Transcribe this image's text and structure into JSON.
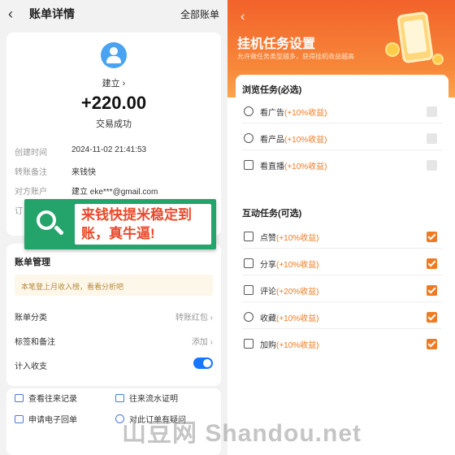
{
  "left": {
    "back_glyph": "‹",
    "title": "账单详情",
    "all_bills": "全部账单",
    "payee": "建立 ›",
    "amount": "+220.00",
    "status": "交易成功",
    "details": [
      {
        "key": "创建时间",
        "value": "2024-11-02 21:41:53"
      },
      {
        "key": "转账备注",
        "value": "来钱快"
      },
      {
        "key": "对方账户",
        "value": "建立 eke***@gmail.com"
      },
      {
        "key": "订",
        "value": ""
      }
    ],
    "banner_text": "来钱快提米稳定到账，真牛逼!",
    "manage": {
      "title": "账单管理",
      "tip": "本笔登上月收入榜，看看分析吧",
      "category_label": "账单分类",
      "category_value": "转账红包 ›",
      "tags_label": "标签和备注",
      "tags_value": "添加 ›",
      "income_label": "计入收支"
    },
    "links": {
      "records": "查看往来记录",
      "flow_proof": "往来流水证明",
      "e_receipt": "申请电子回单",
      "doubt": "对此订单有疑问"
    }
  },
  "right": {
    "back_glyph": "‹",
    "title": "挂机任务设置",
    "subtitle": "允许做任务类型越多，获得挂机收益越高",
    "browse": {
      "title": "浏览任务(必选)",
      "items": [
        {
          "label": "看广告",
          "bonus": "(+10%收益)"
        },
        {
          "label": "看产品",
          "bonus": "(+10%收益)"
        },
        {
          "label": "看直播",
          "bonus": "(+10%收益)"
        }
      ]
    },
    "interact": {
      "title": "互动任务(可选)",
      "items": [
        {
          "label": "点赞",
          "bonus": "(+10%收益)"
        },
        {
          "label": "分享",
          "bonus": "(+10%收益)"
        },
        {
          "label": "评论",
          "bonus": "(+20%收益)"
        },
        {
          "label": "收藏",
          "bonus": "(+10%收益)"
        },
        {
          "label": "加购",
          "bonus": "(+10%收益)"
        }
      ]
    }
  },
  "watermark": "山豆网 Shandou.net",
  "colors": {
    "accent_blue": "#1677ff",
    "accent_orange": "#f07a22",
    "banner_green": "#24a36a",
    "banner_text": "#e84a2c"
  }
}
